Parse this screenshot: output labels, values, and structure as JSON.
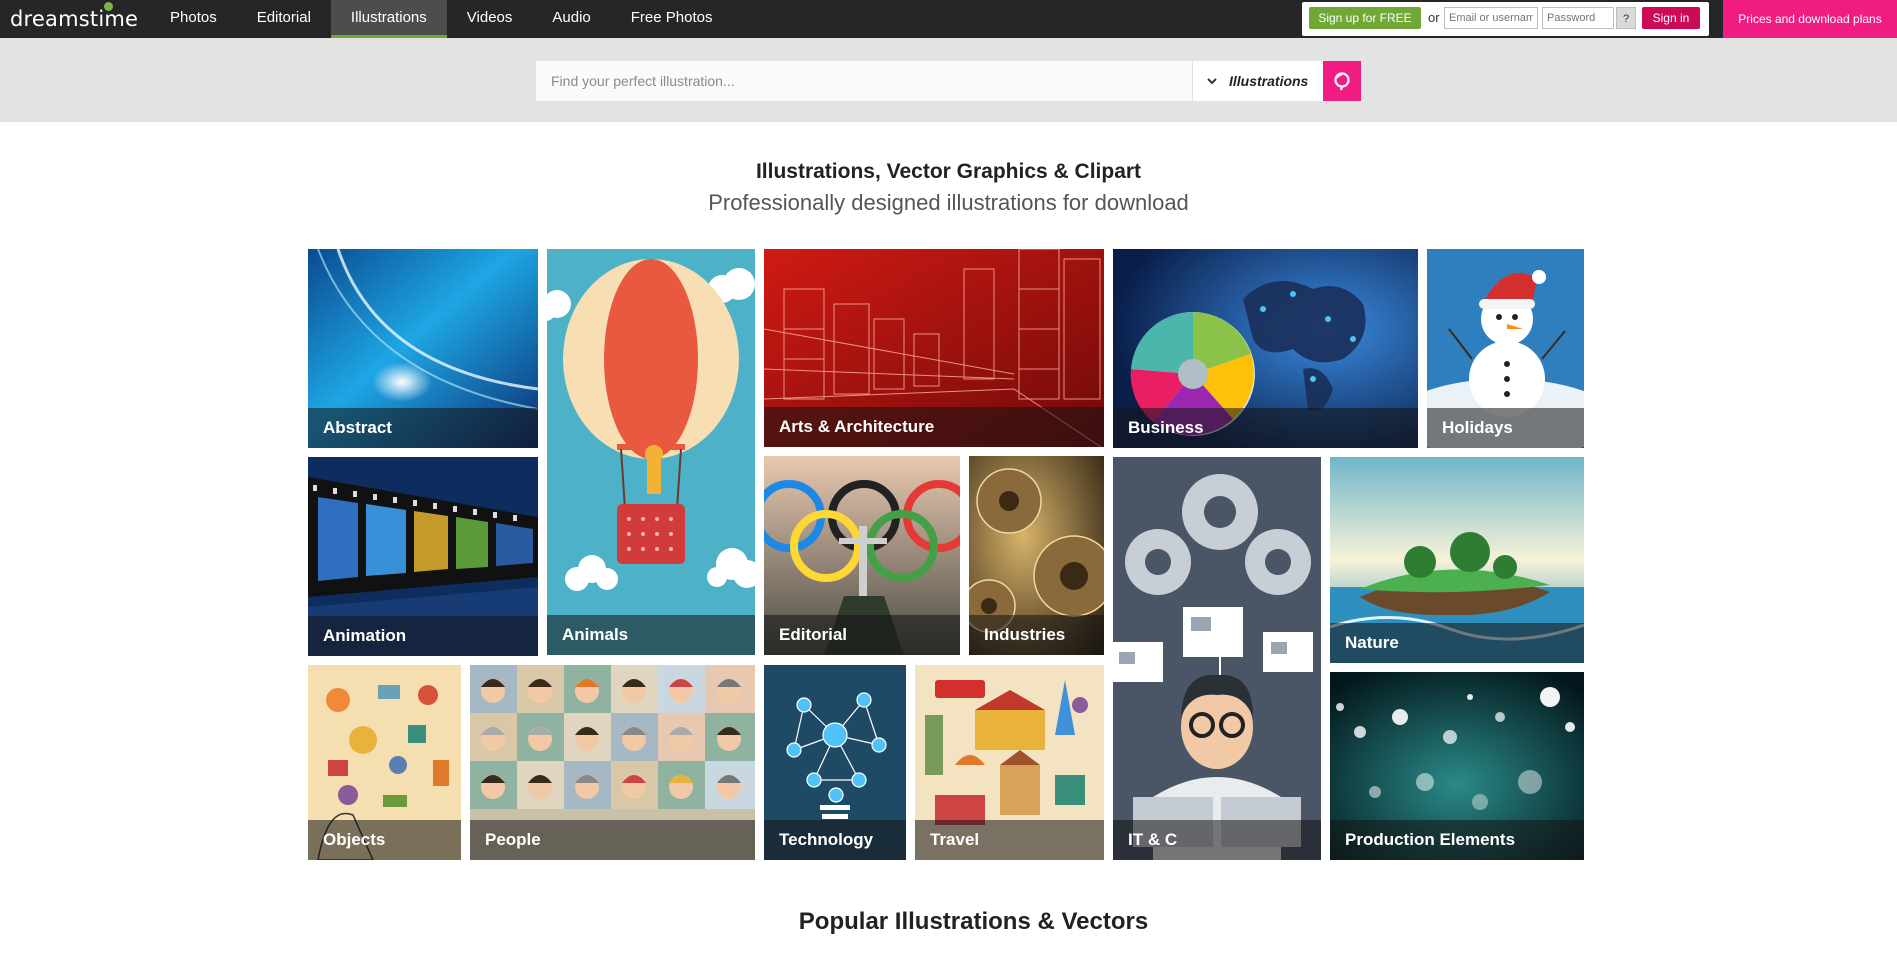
{
  "brand": {
    "logo_text": "dreamstime",
    "accent_color": "#6fa834",
    "pink": "#f11c82"
  },
  "nav": {
    "items": [
      {
        "label": "Photos"
      },
      {
        "label": "Editorial"
      },
      {
        "label": "Illustrations",
        "active": true
      },
      {
        "label": "Videos"
      },
      {
        "label": "Audio"
      },
      {
        "label": "Free Photos"
      }
    ]
  },
  "auth": {
    "signup_label": "Sign up for FREE",
    "or_text": "or",
    "email_placeholder": "Email or username",
    "password_placeholder": "Password",
    "help_label": "?",
    "signin_label": "Sign in"
  },
  "pricing": {
    "label": "Prices and download plans"
  },
  "search": {
    "placeholder": "Find your perfect illustration...",
    "scope": "Illustrations",
    "search_icon": "search-icon"
  },
  "headings": {
    "title": "Illustrations, Vector Graphics & Clipart",
    "subtitle": "Professionally designed illustrations for download",
    "popular": "Popular Illustrations & Vectors"
  },
  "categories": [
    {
      "label": "Abstract"
    },
    {
      "label": "Animals"
    },
    {
      "label": "Arts & Architecture"
    },
    {
      "label": "Business"
    },
    {
      "label": "Holidays"
    },
    {
      "label": "Animation"
    },
    {
      "label": "Editorial"
    },
    {
      "label": "Industries"
    },
    {
      "label": "IT & C"
    },
    {
      "label": "Nature"
    },
    {
      "label": "Objects"
    },
    {
      "label": "People"
    },
    {
      "label": "Technology"
    },
    {
      "label": "Travel"
    },
    {
      "label": "Production Elements"
    }
  ]
}
